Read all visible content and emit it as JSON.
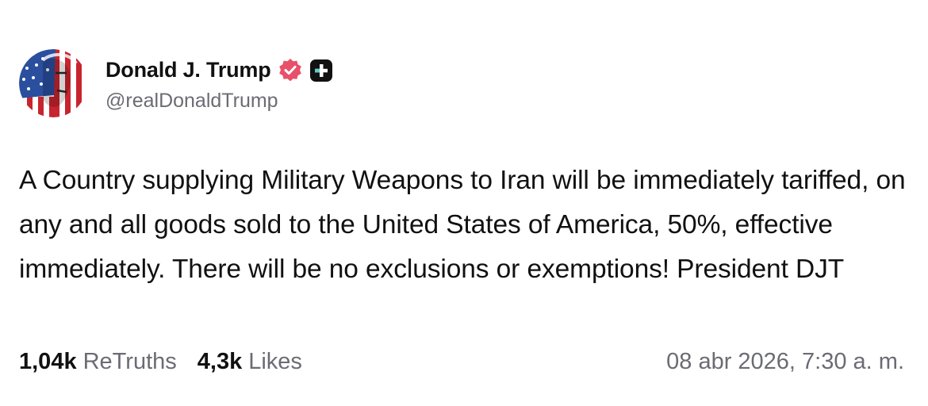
{
  "author": {
    "display_name": "Donald J. Trump",
    "handle": "@realDonaldTrump",
    "avatar": "avatar-flag-portrait",
    "verified_icon": "verified-badge-icon",
    "plus_icon": "plus-badge-icon"
  },
  "post": {
    "text": "A Country supplying Military Weapons to Iran will be immediately tariffed, on any and all goods sold to the United States of America, 50%, effective immediately. There will be no exclusions or exemptions! President DJT"
  },
  "stats": {
    "retruths_count": "1,04k",
    "retruths_label": "ReTruths",
    "likes_count": "4,3k",
    "likes_label": "Likes"
  },
  "timestamp": "08 abr 2026, 7:30 a. m.",
  "colors": {
    "text": "#111111",
    "secondary": "#6b6b74",
    "verified": "#e8506a",
    "badge_dark": "#111111"
  }
}
